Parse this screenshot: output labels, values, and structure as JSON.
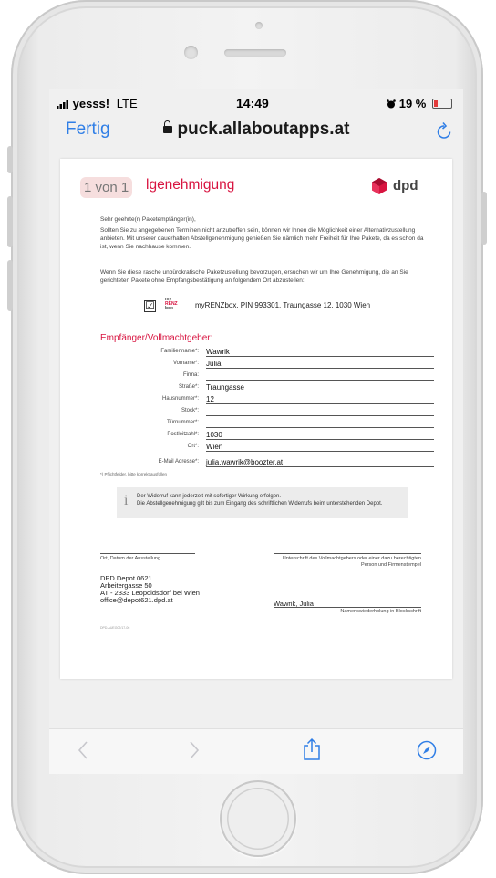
{
  "status_bar": {
    "carrier": "yesss!",
    "network": "LTE",
    "time": "14:49",
    "battery": "19 %"
  },
  "nav": {
    "done_label": "Fertig",
    "url": "puck.allaboutapps.at"
  },
  "doc": {
    "page_indicator": "1 von 1",
    "title_partial": "lgenehmigung",
    "brand": "dpd",
    "greeting": "Sehr geehrte(r) Paketempfänger(in),",
    "intro": "Sollten Sie zu angegebenen Terminen nicht anzutreffen sein, können wir Ihnen die Möglichkeit einer Alternativzustellung anbieten. Mit unserer dauerhaften Abstellgenehmigung genießen Sie nämlich mehr Freiheit für Ihre Pakete, da es schon da ist, wenn Sie nachhause kommen.",
    "request": "Wenn Sie diese rasche unbürokratische Paketzustellung bevorzugen, ersuchen wir um Ihre Genehmigung, die an Sie gerichteten Pakete ohne Empfangsbestätigung an folgendem Ort abzustellen:",
    "checkbox_mark": "☑",
    "myrenz_logo": {
      "l1": "my",
      "l2": "RENZ",
      "l3": "box"
    },
    "box_option": "myRENZbox, PIN 993301, Traungasse 12, 1030 Wien",
    "section_title": "Empfänger/Vollmachtgeber:",
    "fields": [
      {
        "label": "Familienname*:",
        "value": "Wawrik"
      },
      {
        "label": "Vorname*:",
        "value": "Julia"
      },
      {
        "label": "Firma:",
        "value": ""
      },
      {
        "label": "Straße*:",
        "value": "Traungasse"
      },
      {
        "label": "Hausnummer*:",
        "value": "12"
      },
      {
        "label": "Stock*:",
        "value": ""
      },
      {
        "label": "Türnummer*:",
        "value": ""
      },
      {
        "label": "Postleitzahl*:",
        "value": "1030"
      },
      {
        "label": "Ort*:",
        "value": "Wien"
      },
      {
        "label": "E-Mail Adresse*:",
        "value": "julia.wawrik@boozter.at"
      }
    ],
    "required_hint": "*) Pflichtfelder, bitte korrekt ausfüllen",
    "info_icon": "i",
    "info_line1": "Der Widerruf kann jederzeit mit sofortiger Wirkung erfolgen.",
    "info_line2": "Die Abstellgenehmigung gilt bis zum Eingang des schriftlichen Widerrufs beim unterstehenden Depot.",
    "sig_left_caption": "Ort, Datum der Ausstellung",
    "sig_right_caption": "Unterschrift des Vollmachtgebers oder einer dazu berechtigten Person und Firmenstempel",
    "depot_lines": [
      "DPD Depot 0621",
      "Arbeitergasse 50",
      "AT - 2333 Leopoldsdorf bei Wien",
      "office@depot621.dpd.at"
    ],
    "signer_name": "Wawrik, Julia",
    "signer_caption": "Namenswiederholung in Blockschrift",
    "footnote": "DPD-AUEG02/17-06"
  },
  "toolbar": {
    "back_icon": "chevron-left-icon",
    "forward_icon": "chevron-right-icon",
    "share_icon": "share-icon",
    "browser_icon": "compass-icon"
  },
  "colors": {
    "accent_blue": "#2f7ee6",
    "dpd_red": "#d81440"
  }
}
